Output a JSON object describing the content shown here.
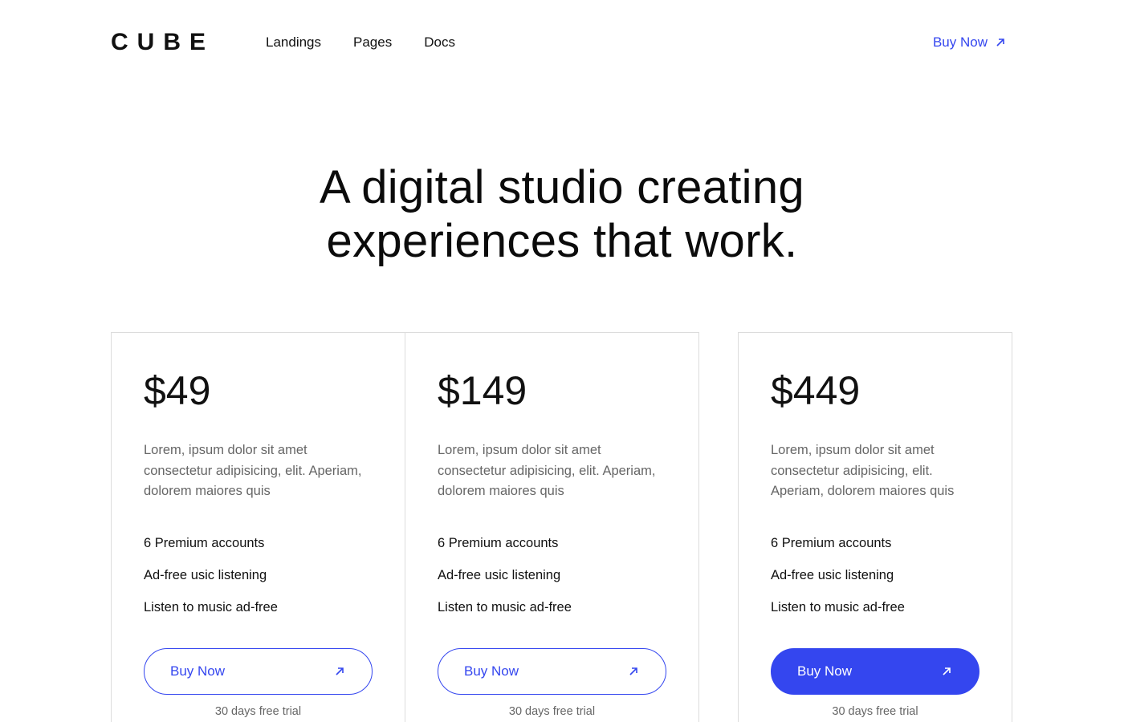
{
  "header": {
    "logo": "CUBE",
    "nav": [
      "Landings",
      "Pages",
      "Docs"
    ],
    "buy_label": "Buy Now"
  },
  "hero": {
    "line1": "A digital studio creating",
    "line2": "experiences that work."
  },
  "plans": [
    {
      "price": "$49",
      "description": "Lorem, ipsum dolor sit amet consectetur adipisicing, elit. Aperiam, dolorem maiores quis",
      "features": [
        "6 Premium accounts",
        "Ad-free usic listening",
        "Listen to music ad-free"
      ],
      "button_label": "Buy Now",
      "trial": "30 days free trial"
    },
    {
      "price": "$149",
      "description": "Lorem, ipsum dolor sit amet consectetur adipisicing, elit. Aperiam, dolorem maiores quis",
      "features": [
        "6 Premium accounts",
        "Ad-free usic listening",
        "Listen to music ad-free"
      ],
      "button_label": "Buy Now",
      "trial": "30 days free trial"
    },
    {
      "price": "$449",
      "description": "Lorem, ipsum dolor sit amet consectetur adipisicing, elit. Aperiam, dolorem maiores quis",
      "features": [
        "6 Premium accounts",
        "Ad-free usic listening",
        "Listen to music ad-free"
      ],
      "button_label": "Buy Now",
      "trial": "30 days free trial"
    }
  ],
  "icons": {
    "buy_arrow": "arrow-up-right-icon"
  },
  "colors": {
    "accent": "#3446ef",
    "text": "#111111",
    "muted": "#666666",
    "border": "#dcdcdc"
  }
}
